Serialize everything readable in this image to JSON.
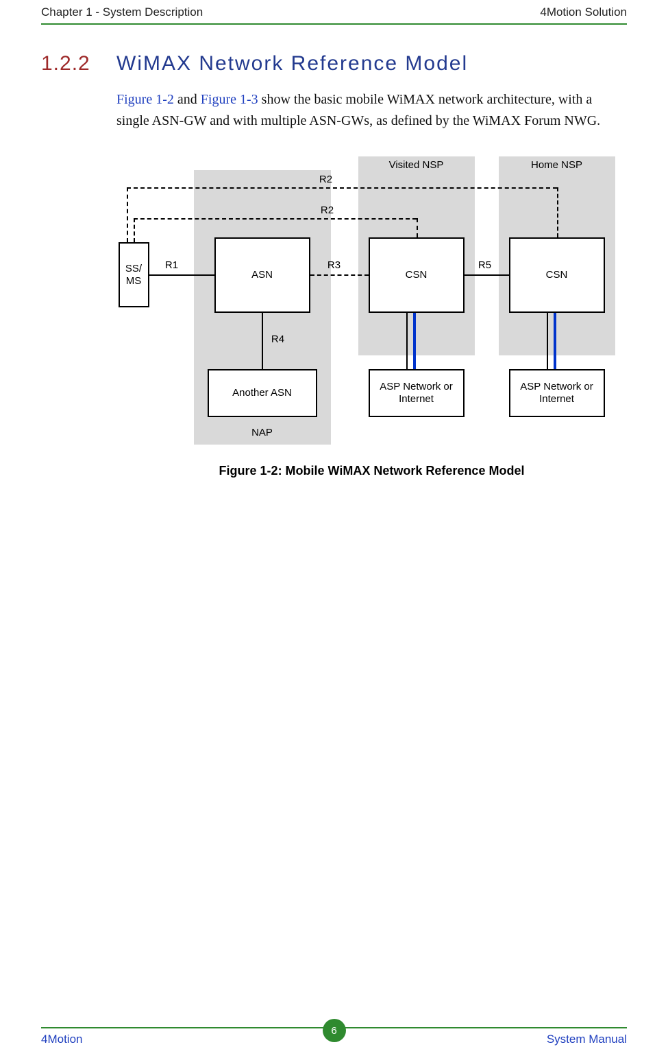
{
  "header": {
    "left": "Chapter 1 - System Description",
    "right": "4Motion Solution"
  },
  "section": {
    "number": "1.2.2",
    "title": "WiMAX Network Reference Model"
  },
  "body": {
    "link1": "Figure 1-2",
    "mid1": " and ",
    "link2": "Figure 1-3",
    "rest": " show the basic mobile WiMAX network architecture, with a single ASN-GW and with multiple ASN-GWs, as defined by the WiMAX Forum NWG."
  },
  "diagram": {
    "group_visited": "Visited NSP",
    "group_home": "Home NSP",
    "nap": "NAP",
    "ssms": "SS/\nMS",
    "asn": "ASN",
    "another_asn": "Another ASN",
    "csn1": "CSN",
    "csn2": "CSN",
    "asp1": "ASP Network or\nInternet",
    "asp2": "ASP Network  or\nInternet",
    "r1": "R1",
    "r2a": "R2",
    "r2b": "R2",
    "r3": "R3",
    "r4": "R4",
    "r5": "R5"
  },
  "figure_caption": "Figure 1-2: Mobile WiMAX Network Reference Model",
  "footer": {
    "left": "4Motion",
    "right": "System Manual",
    "page": "6"
  }
}
